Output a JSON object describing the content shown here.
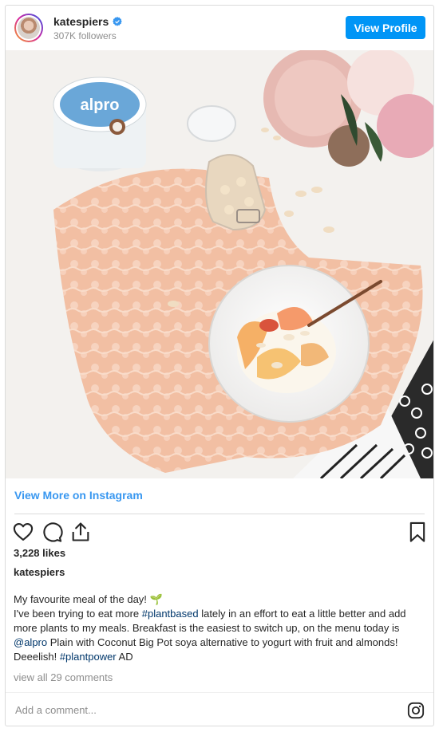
{
  "header": {
    "username": "katespiers",
    "followers": "307K followers",
    "view_profile_label": "View Profile"
  },
  "photo": {
    "jar_brand": "alpro"
  },
  "view_more_label": "View More on Instagram",
  "stats": {
    "likes": "3,228 likes"
  },
  "owner": "katespiers",
  "caption": {
    "line1": "My favourite meal of the day! 🌱",
    "p1": "I've been trying to eat more ",
    "tag1": "#plantbased",
    "p2": " lately in an effort to eat a little better and add more plants to my meals. Breakfast is the easiest to switch up, on the menu today is ",
    "tag2": "@alpro",
    "p3": " Plain with Coconut Big Pot soya alternative to yogurt with fruit and almonds! Deeelish! ",
    "tag3": "#plantpower",
    "p4": " AD"
  },
  "comments_link": "view all 29 comments",
  "comment_box": {
    "placeholder": "Add a comment..."
  },
  "icons": {
    "verified": "verified-badge-icon",
    "like": "heart-icon",
    "comment": "comment-bubble-icon",
    "share": "share-upload-icon",
    "save": "bookmark-icon",
    "instagram": "instagram-logo-icon"
  },
  "colors": {
    "accent": "#0095f6",
    "link": "#3897f0",
    "hashtag": "#00376b",
    "muted": "#8e8e8e",
    "border": "#dbdbdb"
  }
}
